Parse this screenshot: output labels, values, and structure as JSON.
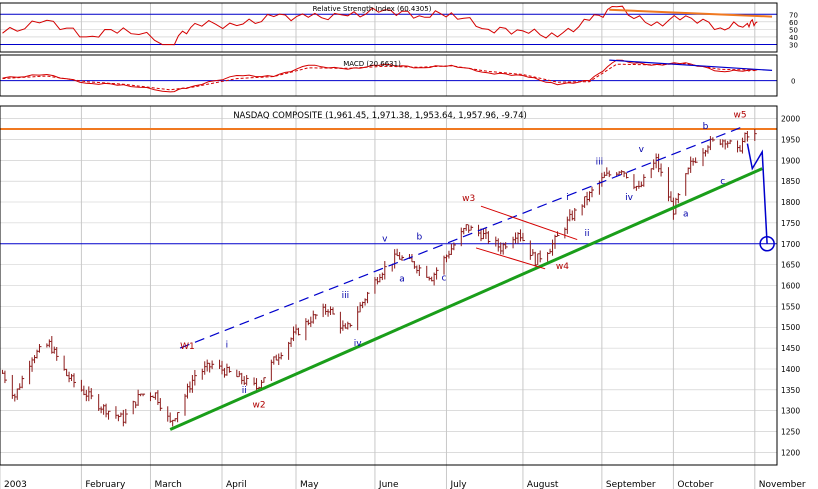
{
  "colors": {
    "grid": "#c8c8c8",
    "frame": "#000000",
    "price_bars": "#8b1a1a",
    "indicator": "#d40000",
    "reference": "#0000cc",
    "channel_upper": "#0000cc",
    "trendline_support": "#1a9e1a",
    "resistance": "#f07820",
    "wave_label_red": "#b00000",
    "wave_label_blue": "#0000aa"
  },
  "chart_data": [
    {
      "type": "line",
      "title": "Relative Strength Index (60.4305)",
      "ylim": [
        20,
        85
      ],
      "y_ticks": [
        70,
        60,
        50,
        40,
        30
      ],
      "reference_levels": [
        70,
        30
      ],
      "x": [
        "2003-01-02",
        "2003-01-20",
        "2003-02-05",
        "2003-02-20",
        "2003-03-11",
        "2003-03-21",
        "2003-04-07",
        "2003-04-22",
        "2003-05-06",
        "2003-05-22",
        "2003-06-06",
        "2003-06-20",
        "2003-07-03",
        "2003-07-18",
        "2003-08-01",
        "2003-08-15",
        "2003-08-28",
        "2003-09-08",
        "2003-09-22",
        "2003-10-06",
        "2003-10-20",
        "2003-10-31",
        "2003-11-04"
      ],
      "series": [
        {
          "values": [
            45,
            62,
            40,
            52,
            30,
            58,
            55,
            67,
            66,
            68,
            76,
            68,
            72,
            50,
            48,
            40,
            62,
            80,
            55,
            68,
            52,
            58,
            60
          ]
        }
      ],
      "annotations": [
        {
          "type": "trendline",
          "from": [
            "2003-09-05",
            76
          ],
          "to": [
            "2003-11-10",
            67
          ],
          "color": "orange"
        }
      ]
    },
    {
      "type": "line",
      "title": "MACD (20.6631)",
      "ylim": [
        -30,
        50
      ],
      "y_ticks": [
        0
      ],
      "reference_levels": [
        0
      ],
      "x": [
        "2003-01-02",
        "2003-01-20",
        "2003-02-05",
        "2003-02-20",
        "2003-03-11",
        "2003-03-21",
        "2003-04-07",
        "2003-04-22",
        "2003-05-06",
        "2003-05-22",
        "2003-06-06",
        "2003-06-20",
        "2003-07-03",
        "2003-07-18",
        "2003-08-01",
        "2003-08-15",
        "2003-08-28",
        "2003-09-08",
        "2003-09-22",
        "2003-10-06",
        "2003-10-20",
        "2003-10-31",
        "2003-11-04"
      ],
      "series": [
        {
          "name": "MACD",
          "values": [
            5,
            12,
            -5,
            -8,
            -22,
            -10,
            10,
            8,
            30,
            22,
            32,
            25,
            30,
            15,
            10,
            -8,
            0,
            40,
            30,
            35,
            18,
            20,
            21
          ]
        },
        {
          "name": "Signal",
          "values": [
            4,
            9,
            -2,
            -7,
            -18,
            -12,
            4,
            8,
            25,
            24,
            28,
            26,
            29,
            18,
            12,
            -3,
            -2,
            32,
            31,
            33,
            22,
            21,
            20
          ]
        }
      ],
      "annotations": [
        {
          "type": "trendline",
          "from": [
            "2003-09-05",
            40
          ],
          "to": [
            "2003-11-10",
            20
          ],
          "color": "blue"
        }
      ]
    },
    {
      "type": "ohlc",
      "title": "NASDAQ COMPOSITE (1,961.45, 1,971.38, 1,953.64, 1,957.96, -9.74)",
      "x_axis": "date",
      "xlim": [
        "2003-01-01",
        "2003-11-12"
      ],
      "ylim": [
        1170,
        2030
      ],
      "y_ticks": [
        2000,
        1950,
        1900,
        1850,
        1800,
        1750,
        1700,
        1650,
        1600,
        1550,
        1500,
        1450,
        1400,
        1350,
        1300,
        1250,
        1200
      ],
      "month_labels": [
        {
          "label": "2003",
          "date": "2003-01-01"
        },
        {
          "label": "February",
          "date": "2003-02-03"
        },
        {
          "label": "March",
          "date": "2003-03-03"
        },
        {
          "label": "April",
          "date": "2003-04-01"
        },
        {
          "label": "May",
          "date": "2003-05-01"
        },
        {
          "label": "June",
          "date": "2003-06-02"
        },
        {
          "label": "July",
          "date": "2003-07-01"
        },
        {
          "label": "August",
          "date": "2003-08-01"
        },
        {
          "label": "September",
          "date": "2003-09-02"
        },
        {
          "label": "October",
          "date": "2003-10-01"
        },
        {
          "label": "November",
          "date": "2003-11-03"
        }
      ],
      "close_path": [
        [
          "2003-01-02",
          1390
        ],
        [
          "2003-01-07",
          1335
        ],
        [
          "2003-01-14",
          1430
        ],
        [
          "2003-01-21",
          1460
        ],
        [
          "2003-01-28",
          1385
        ],
        [
          "2003-02-04",
          1345
        ],
        [
          "2003-02-11",
          1310
        ],
        [
          "2003-02-20",
          1280
        ],
        [
          "2003-02-27",
          1340
        ],
        [
          "2003-03-05",
          1340
        ],
        [
          "2003-03-11",
          1270
        ],
        [
          "2003-03-14",
          1300
        ],
        [
          "2003-03-21",
          1385
        ],
        [
          "2003-03-28",
          1410
        ],
        [
          "2003-04-04",
          1390
        ],
        [
          "2003-04-09",
          1375
        ],
        [
          "2003-04-15",
          1355
        ],
        [
          "2003-04-22",
          1420
        ],
        [
          "2003-04-30",
          1480
        ],
        [
          "2003-05-07",
          1520
        ],
        [
          "2003-05-14",
          1545
        ],
        [
          "2003-05-21",
          1490
        ],
        [
          "2003-05-28",
          1560
        ],
        [
          "2003-06-04",
          1630
        ],
        [
          "2003-06-11",
          1670
        ],
        [
          "2003-06-18",
          1650
        ],
        [
          "2003-06-25",
          1620
        ],
        [
          "2003-07-02",
          1680
        ],
        [
          "2003-07-09",
          1740
        ],
        [
          "2003-07-16",
          1720
        ],
        [
          "2003-07-23",
          1690
        ],
        [
          "2003-07-30",
          1730
        ],
        [
          "2003-08-06",
          1660
        ],
        [
          "2003-08-12",
          1690
        ],
        [
          "2003-08-20",
          1760
        ],
        [
          "2003-08-27",
          1810
        ],
        [
          "2003-09-03",
          1860
        ],
        [
          "2003-09-10",
          1880
        ],
        [
          "2003-09-17",
          1830
        ],
        [
          "2003-09-24",
          1900
        ],
        [
          "2003-10-01",
          1780
        ],
        [
          "2003-10-08",
          1890
        ],
        [
          "2003-10-15",
          1940
        ],
        [
          "2003-10-22",
          1950
        ],
        [
          "2003-10-27",
          1920
        ],
        [
          "2003-10-30",
          1955
        ],
        [
          "2003-11-03",
          1958
        ]
      ],
      "reference_lines": [
        {
          "type": "horizontal",
          "y": 1975,
          "color": "orange"
        },
        {
          "type": "horizontal",
          "y": 1700,
          "color": "blue"
        }
      ],
      "trendlines": [
        {
          "from": [
            "2003-03-11",
            1255
          ],
          "to": [
            "2003-11-06",
            1880
          ],
          "color": "green"
        },
        {
          "from": [
            "2003-03-15",
            1450
          ],
          "to": [
            "2003-10-29",
            1980
          ],
          "color": "blue",
          "dashed": true
        }
      ],
      "projection": [
        [
          "2003-10-31",
          1940
        ],
        [
          "2003-11-02",
          1880
        ],
        [
          "2003-11-06",
          1920
        ],
        [
          "2003-11-08",
          1700
        ]
      ],
      "target_circle": {
        "date": "2003-11-08",
        "y": 1700
      },
      "wave_labels": [
        {
          "text": "W1",
          "date": "2003-03-18",
          "y": 1448,
          "color": "red"
        },
        {
          "text": "i",
          "date": "2003-04-03",
          "y": 1452,
          "color": "blue"
        },
        {
          "text": "ii",
          "date": "2003-04-10",
          "y": 1343,
          "color": "blue"
        },
        {
          "text": "w2",
          "date": "2003-04-16",
          "y": 1308,
          "color": "red"
        },
        {
          "text": "iii",
          "date": "2003-05-21",
          "y": 1570,
          "color": "blue"
        },
        {
          "text": "iv",
          "date": "2003-05-26",
          "y": 1455,
          "color": "blue"
        },
        {
          "text": "v",
          "date": "2003-06-06",
          "y": 1705,
          "color": "blue"
        },
        {
          "text": "a",
          "date": "2003-06-13",
          "y": 1610,
          "color": "blue"
        },
        {
          "text": "b",
          "date": "2003-06-20",
          "y": 1710,
          "color": "blue"
        },
        {
          "text": "c",
          "date": "2003-06-30",
          "y": 1612,
          "color": "blue"
        },
        {
          "text": "w3",
          "date": "2003-07-10",
          "y": 1803,
          "color": "red"
        },
        {
          "text": "w4",
          "date": "2003-08-17",
          "y": 1640,
          "color": "red"
        },
        {
          "text": "i",
          "date": "2003-08-19",
          "y": 1805,
          "color": "blue"
        },
        {
          "text": "ii",
          "date": "2003-08-27",
          "y": 1718,
          "color": "blue"
        },
        {
          "text": "iii",
          "date": "2003-09-01",
          "y": 1890,
          "color": "blue"
        },
        {
          "text": "iv",
          "date": "2003-09-13",
          "y": 1805,
          "color": "blue"
        },
        {
          "text": "v",
          "date": "2003-09-18",
          "y": 1920,
          "color": "blue"
        },
        {
          "text": "a",
          "date": "2003-10-06",
          "y": 1765,
          "color": "blue"
        },
        {
          "text": "b",
          "date": "2003-10-14",
          "y": 1975,
          "color": "blue"
        },
        {
          "text": "c",
          "date": "2003-10-21",
          "y": 1843,
          "color": "blue"
        },
        {
          "text": "w5",
          "date": "2003-10-28",
          "y": 2002,
          "color": "red"
        }
      ]
    }
  ]
}
